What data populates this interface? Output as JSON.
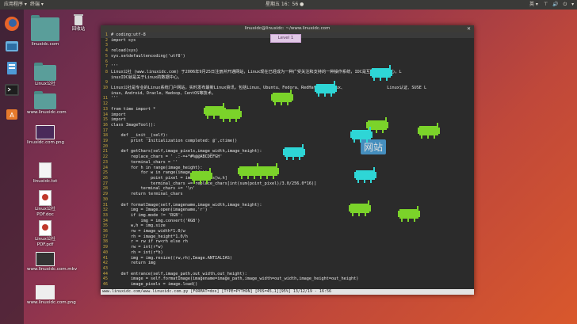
{
  "topbar": {
    "apps_label": "应用程序 ▾",
    "terminal_label": "终端 ▾",
    "clock": "星期五 16：56 ●",
    "lang": "英 ▾",
    "status_icons": "⊤ 🔊 ⏻ ▾"
  },
  "desktop_icons": [
    {
      "label": "回收站"
    },
    {
      "label": "linuxidc.com"
    },
    {
      "label": "Linux公社"
    },
    {
      "label": "www.linuxidc.com"
    },
    {
      "label": "linuxidc.com.png"
    },
    {
      "label": "linuxidc.txt"
    },
    {
      "label": "Linux公社PDF.doc"
    },
    {
      "label": "Linux公社PDF.pdf"
    },
    {
      "label": "www.linuxidc.com.mkv"
    },
    {
      "label": "www.linuxidc.com.png"
    }
  ],
  "window": {
    "title": "linuxidc@linuxidc: ~/www.linuxidc.com",
    "close_icon": "close-icon"
  },
  "level_label": "Level 1",
  "code_lines": [
    {
      "num": "1",
      "text": "# coding:utf-8"
    },
    {
      "num": "2",
      "text": "import sys"
    },
    {
      "num": "3",
      "text": ""
    },
    {
      "num": "4",
      "text": "reload(sys)"
    },
    {
      "num": "5",
      "text": "sys.setdefaultencoding('utf8')"
    },
    {
      "num": "6",
      "text": ""
    },
    {
      "num": "7",
      "text": "'''"
    },
    {
      "num": "8",
      "text": "Linux公社 (www.linuxidc.com) 于2006年9月25日注册并开通网站，Linux现在已经成为一种广受关注和支持的一种操作系统，IDC是互联网数据中心，L"
    },
    {
      "num": "",
      "text": "inuxIDC就是关于Linux的数据中心。"
    },
    {
      "num": "9",
      "text": ""
    },
    {
      "num": "10",
      "text": "Linux公社是专业的Linux系统门户网站，实时发布最新Linux资讯，包括Linux、Ubuntu、Fedora、RedHat、红旗Linux、                 Linux认证、SUSE L"
    },
    {
      "num": "",
      "text": "inux、Android、Oracle、Hadoop、CentOS等技术。"
    },
    {
      "num": "11",
      "text": "'''"
    },
    {
      "num": "12",
      "text": ""
    },
    {
      "num": "13",
      "text": "from time import *"
    },
    {
      "num": "14",
      "text": "import"
    },
    {
      "num": "15",
      "text": "import"
    },
    {
      "num": "16",
      "text": "class ImageTool():"
    },
    {
      "num": "17",
      "text": ""
    },
    {
      "num": "18",
      "text": "    def __init__(self):"
    },
    {
      "num": "19",
      "text": "        print 'Initialization completed: @',ctime()"
    },
    {
      "num": "20",
      "text": ""
    },
    {
      "num": "21",
      "text": "    def getChars(self,image_pixels,image_width,image_height):"
    },
    {
      "num": "22",
      "text": "        replace_chars = ' .:-=+*#%@@ABCDEFGH'"
    },
    {
      "num": "23",
      "text": "        terminal_chars = ''"
    },
    {
      "num": "24",
      "text": "        for h in range(image_height):"
    },
    {
      "num": "25",
      "text": "            for w in range(image_width):"
    },
    {
      "num": "26",
      "text": "                point_pixel = image_pixels[w,h]"
    },
    {
      "num": "27",
      "text": "                terminal_chars += replace_chars[int(sum(point_pixel)/3.0/256.0*16)]"
    },
    {
      "num": "28",
      "text": "            terminal_chars += '\\n'"
    },
    {
      "num": "29",
      "text": "        return terminal_chars"
    },
    {
      "num": "30",
      "text": ""
    },
    {
      "num": "31",
      "text": "    def formatImage(self,imagename,image_width,image_height):"
    },
    {
      "num": "32",
      "text": "        img = Image.open(imagename,'r')"
    },
    {
      "num": "33",
      "text": "        if img.mode != 'RGB':"
    },
    {
      "num": "34",
      "text": "            img = img.convert('RGB')"
    },
    {
      "num": "35",
      "text": "        w,h = img.size"
    },
    {
      "num": "36",
      "text": "        rw = image_width*1.0/w"
    },
    {
      "num": "37",
      "text": "        rh = image_height*1.0/h"
    },
    {
      "num": "38",
      "text": "        r = rw if rw<rh else rh"
    },
    {
      "num": "39",
      "text": "        rw = int(r*w)"
    },
    {
      "num": "40",
      "text": "        rh = int(r*h)"
    },
    {
      "num": "41",
      "text": "        img = img.resize((rw,rh),Image.ANTIALIAS)"
    },
    {
      "num": "42",
      "text": "        return img"
    },
    {
      "num": "43",
      "text": ""
    },
    {
      "num": "44",
      "text": "    def entrance(self,image_path,out_width,out_height):"
    },
    {
      "num": "45",
      "text": "        image = self.formatImage(imagename=image_path,image_width=out_width,image_height=out_height)"
    },
    {
      "num": "46",
      "text": "        image_pixels = image.load()"
    }
  ],
  "status_line": "www.linuxidc.com/www.linuxidc.com.py [FORMAT=dos] [TYPE=PYTHON] [POS=45,1][95%] 13/12/19 - 16:56",
  "colors": {
    "green_bug": "#7bd32a",
    "cyan_bug": "#2ed6d6",
    "panel": "#3a3a38",
    "code_bg": "#2b2b2b"
  },
  "watermark": {
    "net_label": "网站"
  }
}
